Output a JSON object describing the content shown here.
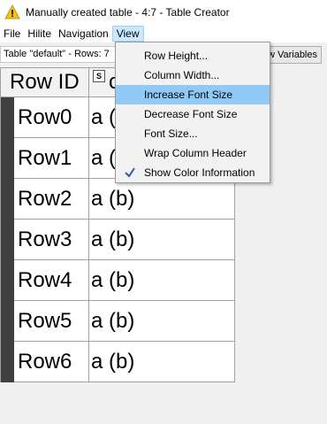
{
  "window": {
    "title": "Manually created table - 4:7 - Table Creator",
    "title_icon": "warning-icon"
  },
  "menubar": {
    "items": [
      "File",
      "Hilite",
      "Navigation",
      "View"
    ],
    "active": "View"
  },
  "infobar": {
    "table_label": "Table \"default\" - Rows: 7",
    "flow_vars_button": "w Variables"
  },
  "table": {
    "header": {
      "rowid": "Row ID",
      "col1": "c",
      "col1_type_badge": "S"
    },
    "rows": [
      {
        "id": "Row0",
        "value": "a ("
      },
      {
        "id": "Row1",
        "value": "a ("
      },
      {
        "id": "Row2",
        "value": "a (b)"
      },
      {
        "id": "Row3",
        "value": "a (b)"
      },
      {
        "id": "Row4",
        "value": "a (b)"
      },
      {
        "id": "Row5",
        "value": "a (b)"
      },
      {
        "id": "Row6",
        "value": "a (b)"
      }
    ],
    "color_strip": "#404040"
  },
  "view_menu": {
    "items": [
      {
        "label": "Row Height...",
        "checked": false,
        "highlighted": false
      },
      {
        "label": "Column Width...",
        "checked": false,
        "highlighted": false
      },
      {
        "label": "Increase Font Size",
        "checked": false,
        "highlighted": true
      },
      {
        "label": "Decrease Font Size",
        "checked": false,
        "highlighted": false
      },
      {
        "label": "Font Size...",
        "checked": false,
        "highlighted": false
      },
      {
        "label": "Wrap Column Header",
        "checked": false,
        "highlighted": false
      },
      {
        "label": "Show Color Information",
        "checked": true,
        "highlighted": false
      }
    ],
    "highlight_color": "#91c9f7",
    "check_icon": "checkmark-icon"
  }
}
